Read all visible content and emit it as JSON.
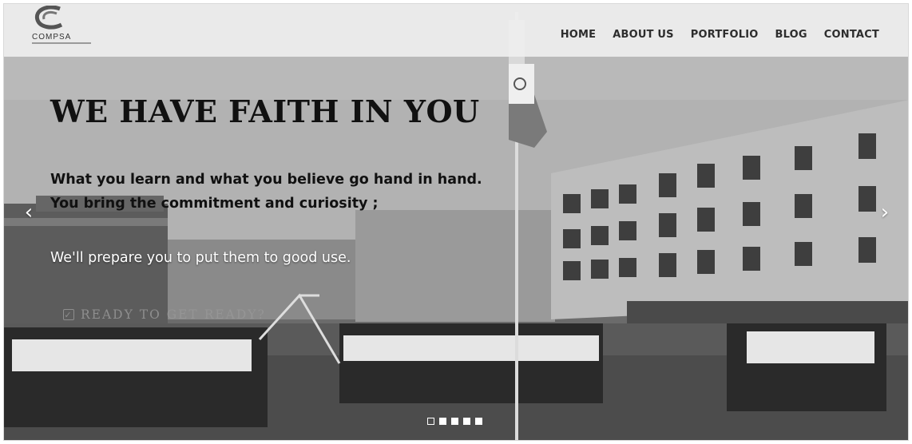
{
  "brand": {
    "name": "COMPSA"
  },
  "nav": {
    "items": [
      {
        "label": "HOME"
      },
      {
        "label": "ABOUT US"
      },
      {
        "label": "PORTFOLIO"
      },
      {
        "label": "BLOG"
      },
      {
        "label": "CONTACT"
      }
    ]
  },
  "slide": {
    "headline": "WE HAVE FAITH IN YOU",
    "line1": "What you learn and what you believe go hand in hand.",
    "line2": "You bring the commitment and curiosity ;",
    "line3": "We'll prepare you to put them to good use.",
    "cta_label": "READY TO GET READY?",
    "cta_icon": "check-square-icon"
  },
  "slider": {
    "prev_icon": "chevron-left-icon",
    "next_icon": "chevron-right-icon",
    "dot_count": 5,
    "active_index": 0
  },
  "colors": {
    "header_bg": "#eeeeee",
    "text_dark": "#111111",
    "nav_text": "#2d2d2d"
  }
}
